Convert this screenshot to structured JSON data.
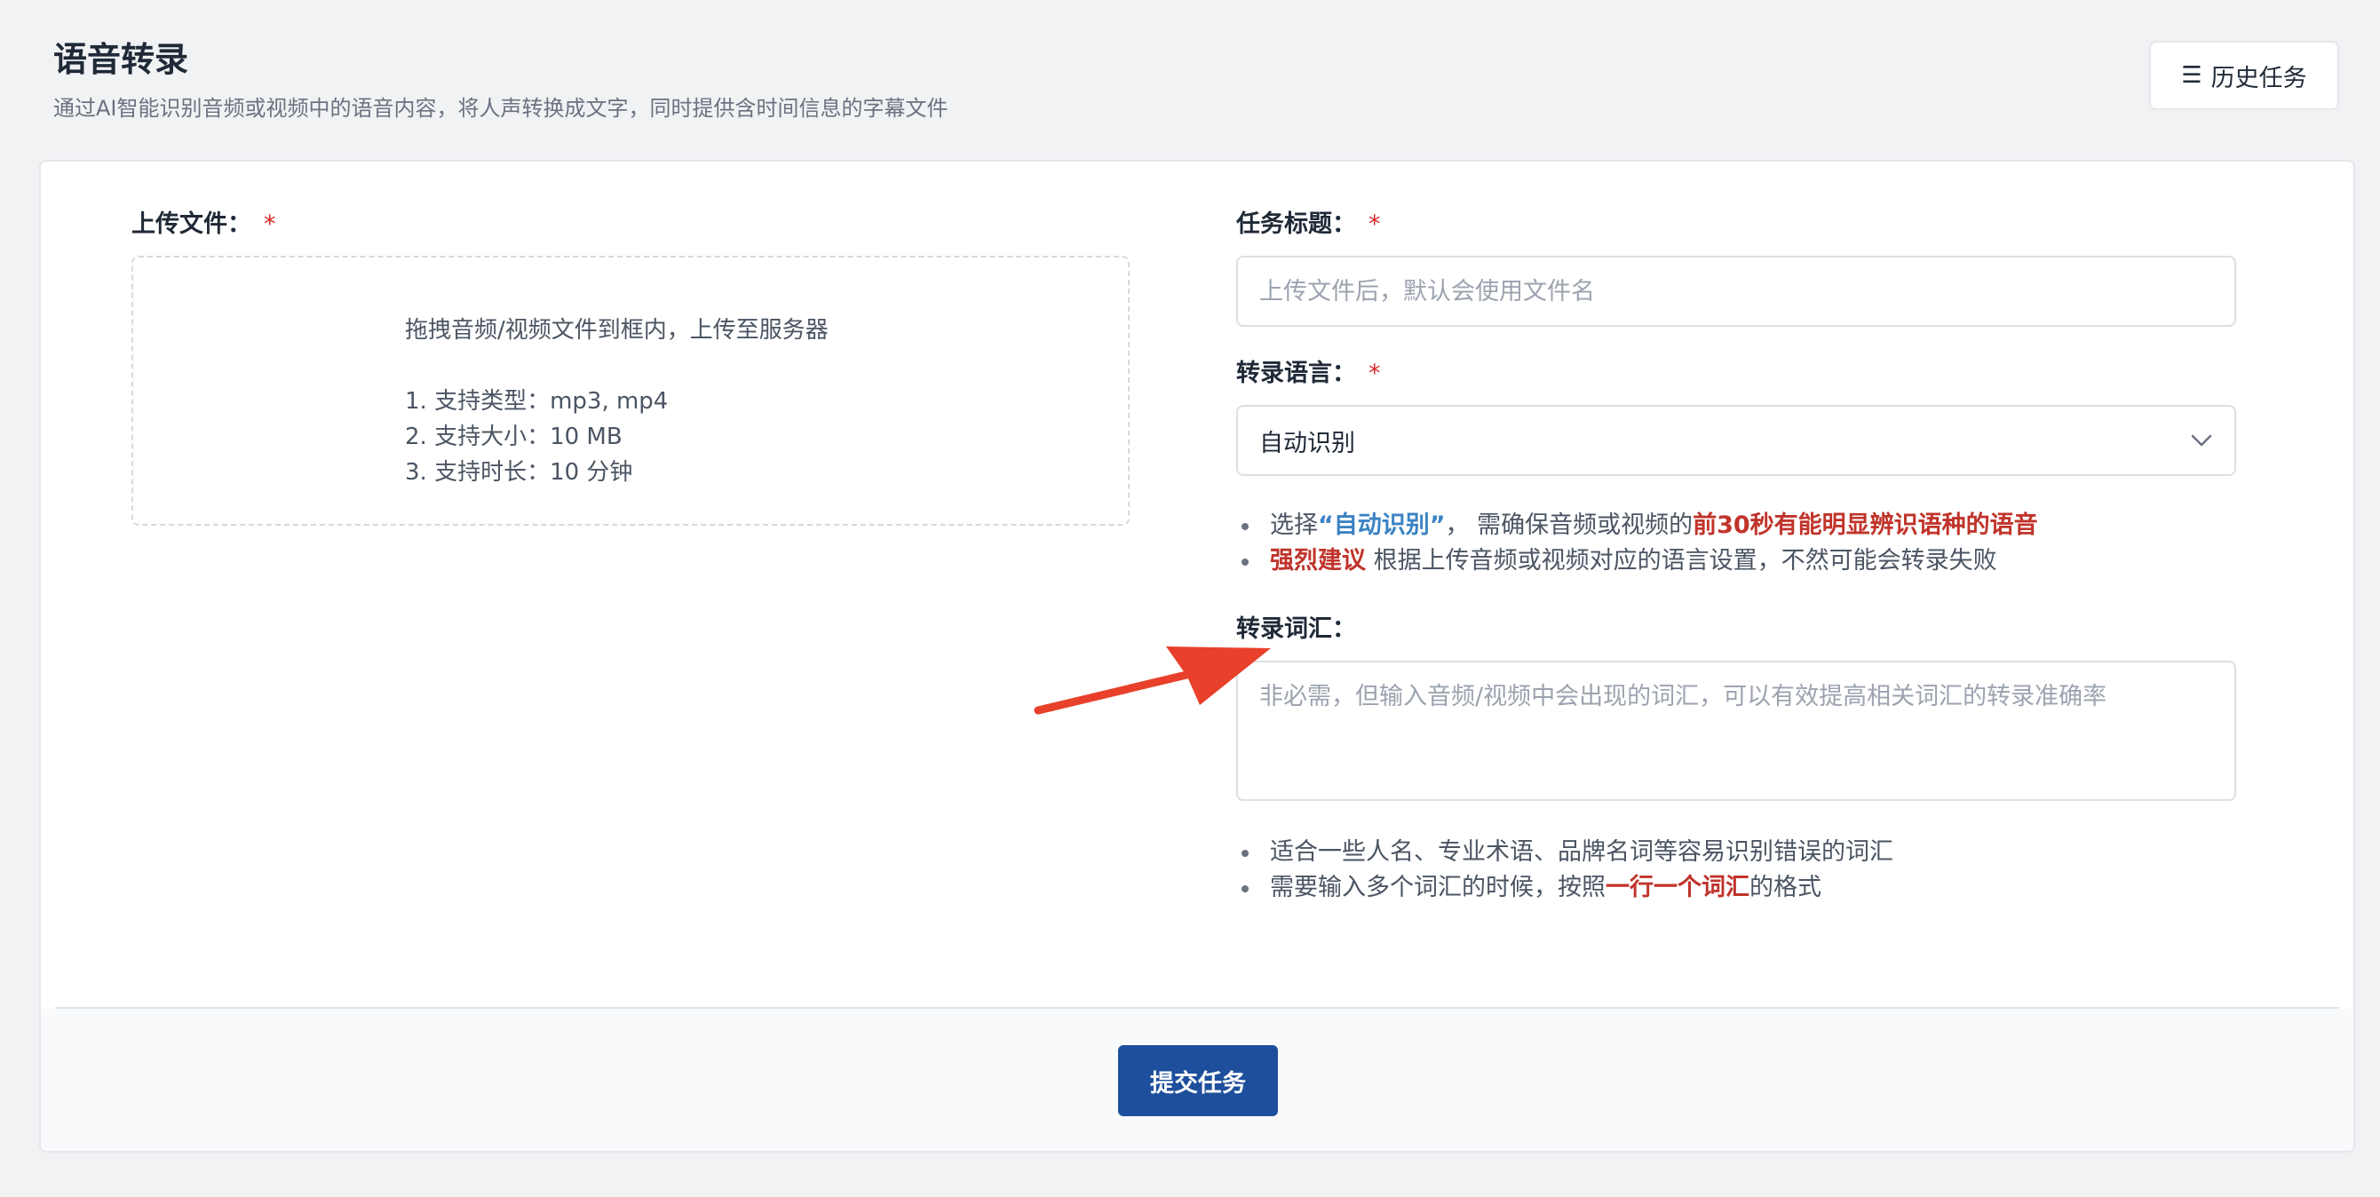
{
  "header": {
    "title": "语音转录",
    "subtitle": "通过AI智能识别音频或视频中的语音内容，将人声转换成文字，同时提供含时间信息的字幕文件",
    "history_icon": "☰",
    "history_label": "历史任务"
  },
  "upload": {
    "label": "上传文件：",
    "required_mark": "*",
    "drop_text": "拖拽音频/视频文件到框内，上传至服务器",
    "rules": [
      "1. 支持类型：mp3, mp4",
      "2. 支持大小：10 MB",
      "3. 支持时长：10 分钟"
    ]
  },
  "task_title": {
    "label": "任务标题：",
    "required_mark": "*",
    "value": "",
    "placeholder": "上传文件后，默认会使用文件名"
  },
  "language": {
    "label": "转录语言：",
    "required_mark": "*",
    "selected": "自动识别",
    "hint1": {
      "prefix": "选择",
      "highlight": "“自动识别”",
      "middle": "， 需确保音频或视频的",
      "emphasis": "前30秒有能明显辨识语种的语音"
    },
    "hint2": {
      "emphasis": "强烈建议",
      "rest": " 根据上传音频或视频对应的语言设置，不然可能会转录失败"
    }
  },
  "vocabulary": {
    "label": "转录词汇：",
    "value": "",
    "placeholder": "非必需，但输入音频/视频中会出现的词汇，可以有效提高相关词汇的转录准确率",
    "hint1": "适合一些人名、专业术语、品牌名词等容易识别错误的词汇",
    "hint2": {
      "prefix": "需要输入多个词汇的时候，按照",
      "emphasis": "一行一个词汇",
      "suffix": "的格式"
    }
  },
  "submit_label": "提交任务",
  "colors": {
    "primary": "#1e4f9c",
    "required": "#dc2626",
    "highlight_blue": "#3b82c4",
    "emphasis_red": "#c0342b",
    "annotation_arrow": "#e8402a"
  },
  "icons": {
    "history": "hamburger-icon",
    "select": "chevron-down-icon",
    "annotation": "arrow-annotation"
  }
}
